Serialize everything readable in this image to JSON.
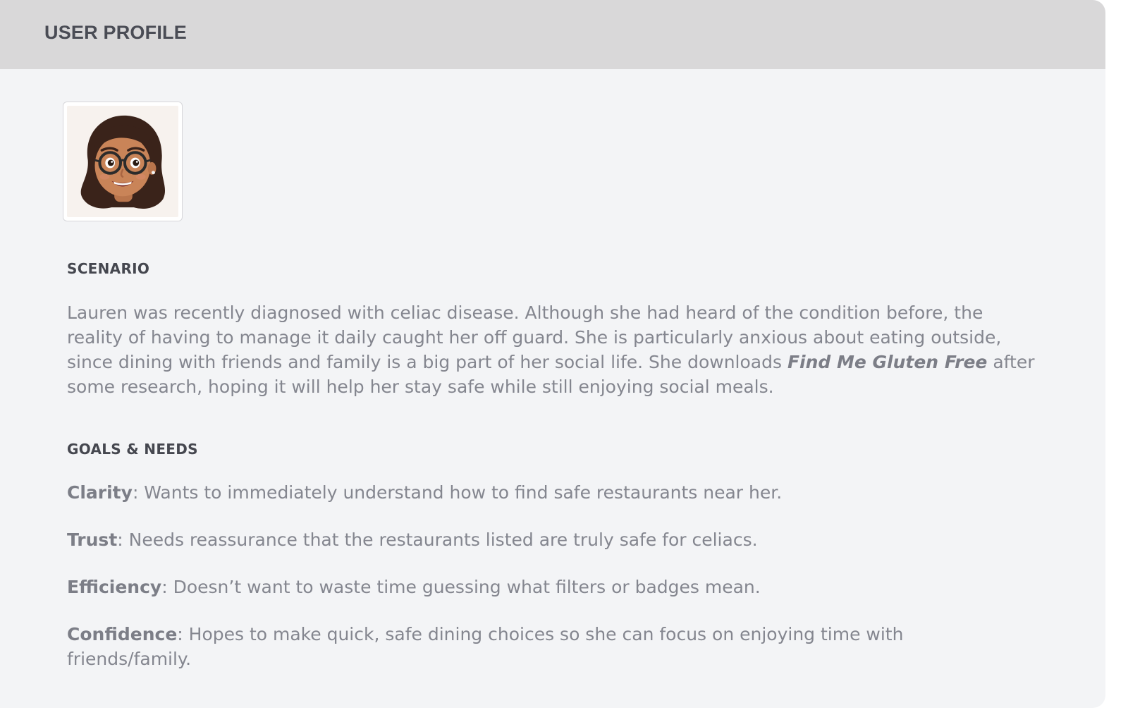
{
  "header": {
    "title": "USER PROFILE"
  },
  "avatar": {
    "icon": "memoji-avatar-icon"
  },
  "scenario": {
    "heading": "SCENARIO",
    "text_before": "Lauren was recently diagnosed with celiac disease. Although she had heard of the condition before, the reality of having to manage it daily caught her off guard. She is particularly anxious about eating outside, since dining with friends and family is a big part of her social life. She downloads ",
    "app_name": "Find Me Gluten Free",
    "text_after": " after some research, hoping it will help her stay safe while still enjoying social meals."
  },
  "goals": {
    "heading": "GOALS & NEEDS",
    "items": [
      {
        "label": "Clarity",
        "text": ": Wants to immediately understand how to find safe restaurants near her."
      },
      {
        "label": "Trust",
        "text": ": Needs reassurance that the restaurants listed are truly safe for celiacs."
      },
      {
        "label": "Efficiency",
        "text": ": Doesn’t want to waste time guessing what filters or badges mean."
      },
      {
        "label": "Confidence",
        "text": ": Hopes to make quick, safe dining choices so she can focus on enjoying time with friends/family."
      }
    ]
  },
  "colors": {
    "header_bg": "#d9d8d9",
    "card_bg": "#f3f4f6",
    "heading_text": "#45474f",
    "body_text": "#84868f"
  }
}
